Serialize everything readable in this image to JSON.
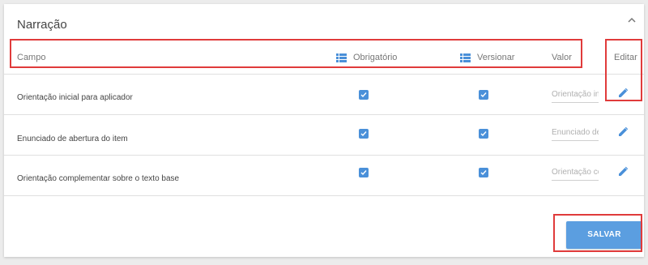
{
  "section": {
    "title": "Narração"
  },
  "table": {
    "headers": {
      "campo": "Campo",
      "obrigatorio": "Obrigatório",
      "versionar": "Versionar",
      "valor": "Valor",
      "editar": "Editar"
    },
    "rows": [
      {
        "label": "Orientação inicial para aplicador",
        "obrigatorio": true,
        "versionar": true,
        "valor_placeholder": "Orientação inicial para aplicador"
      },
      {
        "label": "Enunciado de abertura do item",
        "obrigatorio": true,
        "versionar": true,
        "valor_placeholder": "Enunciado de abertura do item"
      },
      {
        "label": "Orientação complementar sobre o texto base",
        "obrigatorio": true,
        "versionar": true,
        "valor_placeholder": "Orientação complementar sobre o texto base"
      }
    ]
  },
  "actions": {
    "save_label": "SALVAR"
  },
  "colors": {
    "accent": "#4a90d9",
    "button": "#5b9ee0",
    "highlight": "#e03b3b"
  },
  "icons": {
    "header_list": "list-icon",
    "edit": "pencil-icon",
    "collapse": "chevron-up-icon"
  }
}
